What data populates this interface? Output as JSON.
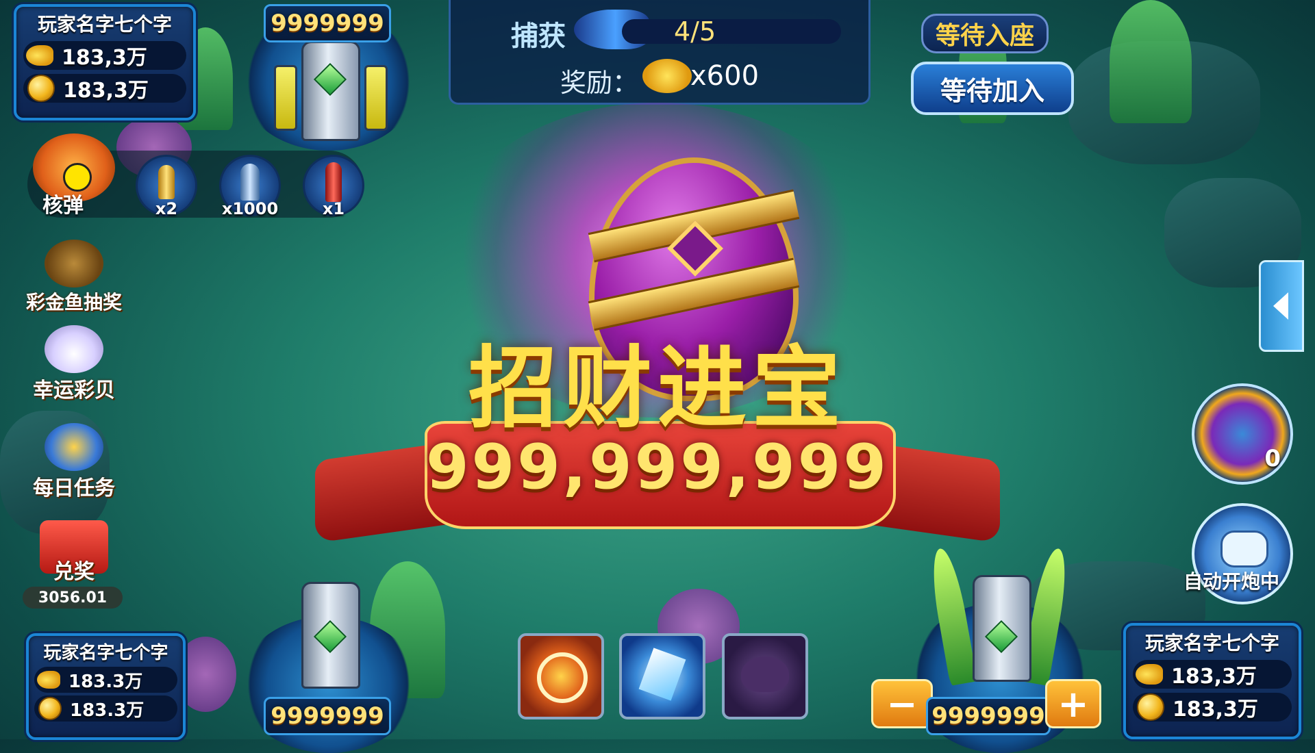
{
  "players": {
    "top_left": {
      "name": "玩家名字七个字",
      "fish_score": "183,3万",
      "coins": "183,3万"
    },
    "bottom_left": {
      "name": "玩家名字七个字",
      "fish_score": "183.3万",
      "coins": "183.3万"
    },
    "bottom_right": {
      "name": "玩家名字七个字",
      "fish_score": "183,3万",
      "coins": "183,3万"
    }
  },
  "cannons": {
    "top_left_value": "9999999",
    "bottom_left_value": "9999999",
    "bottom_right_value": "9999999",
    "minus_label": "−",
    "plus_label": "+"
  },
  "ammo": {
    "nuke_label": "核弹",
    "items": [
      {
        "name": "golden-shell",
        "count": "x2"
      },
      {
        "name": "blue-bomb",
        "count": "x1000"
      },
      {
        "name": "red-rocket",
        "count": "x1"
      }
    ]
  },
  "side_menu": {
    "jackpot_label": "彩金鱼抽奖",
    "lucky_shell_label": "幸运彩贝",
    "daily_task_label": "每日任务",
    "redeem_label": "兑奖",
    "redeem_value": "3056.01"
  },
  "mission": {
    "capture_label": "捕获",
    "progress": "4/5",
    "reward_label": "奖励：",
    "reward_value": "x600"
  },
  "top_right": {
    "wait_seat": "等待入座",
    "wait_join": "等待加入"
  },
  "award": {
    "title": "招财进宝",
    "amount": "999,999,999"
  },
  "right_controls": {
    "skill_count": "0",
    "auto_fire_label": "自动开炮中"
  },
  "colors": {
    "panel_border": "#1b86d6",
    "gold_text": "#ffe27a",
    "ribbon_red": "#d23c30"
  }
}
